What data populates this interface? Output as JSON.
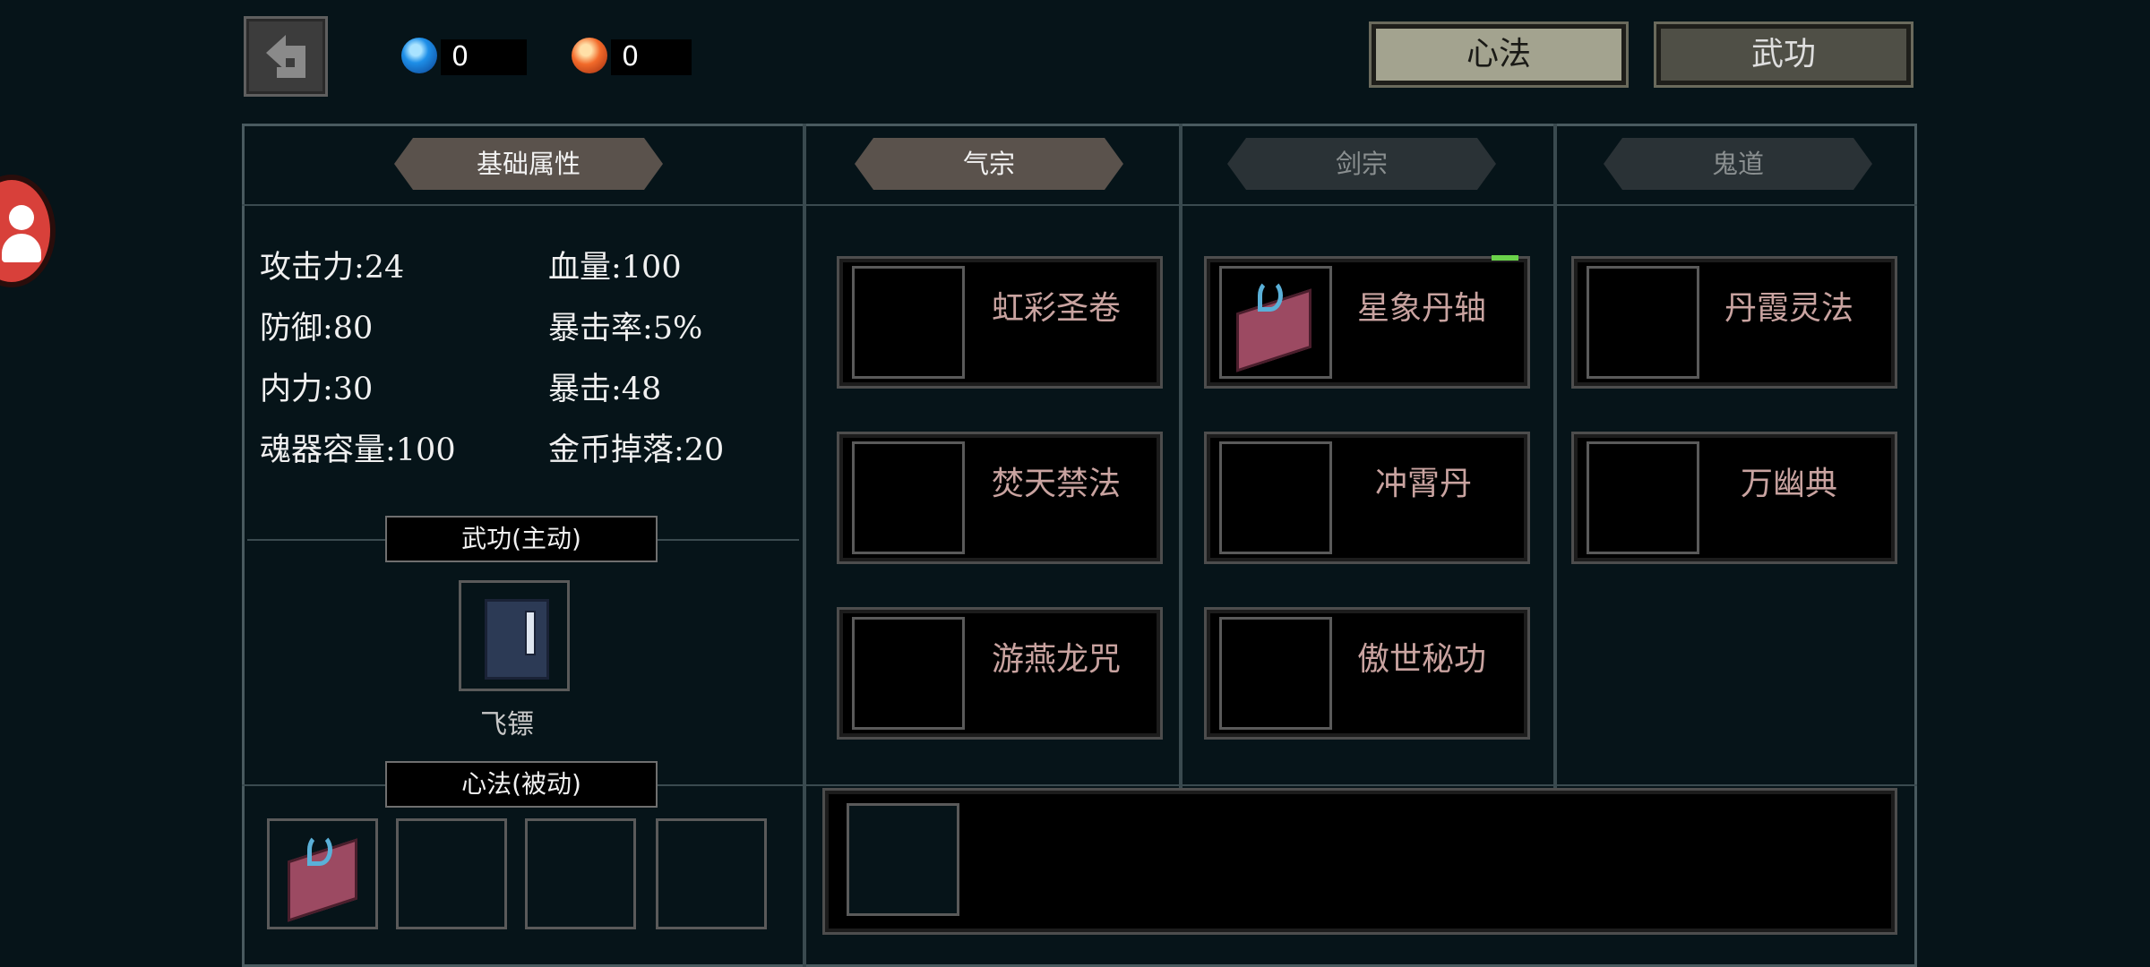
{
  "topbar": {
    "back_icon": "back-arrow-icon",
    "blue_gem": {
      "icon": "blue-gem-icon",
      "value": "0",
      "color": "#1e8fe8"
    },
    "red_gem": {
      "icon": "red-gem-icon",
      "value": "0",
      "color": "#f26a2a"
    },
    "tabs": [
      {
        "label": "心法",
        "active": true
      },
      {
        "label": "武功",
        "active": false
      }
    ]
  },
  "columns": {
    "basic": "基础属性",
    "qi": "气宗",
    "jian": "剑宗",
    "gui": "鬼道"
  },
  "stats": [
    "攻击力:24",
    "血量:100",
    "防御:80",
    "暴击率:5%",
    "内力:30",
    "暴击:48",
    "魂器容量:100",
    "金币掉落:20"
  ],
  "active_skill": {
    "header": "武功(主动)",
    "name": "飞镖"
  },
  "passive_skill": {
    "header": "心法(被动)"
  },
  "skills": {
    "qi": [
      "虹彩圣卷",
      "焚天禁法",
      "游燕龙咒"
    ],
    "jian": [
      "星象丹轴",
      "冲霄丹",
      "傲世秘功"
    ],
    "gui": [
      "丹霞灵法",
      "万幽典"
    ]
  },
  "colors": {
    "accent": "#a3a38f",
    "panel_border": "#495a5f",
    "badge_red": "#e0443a"
  }
}
